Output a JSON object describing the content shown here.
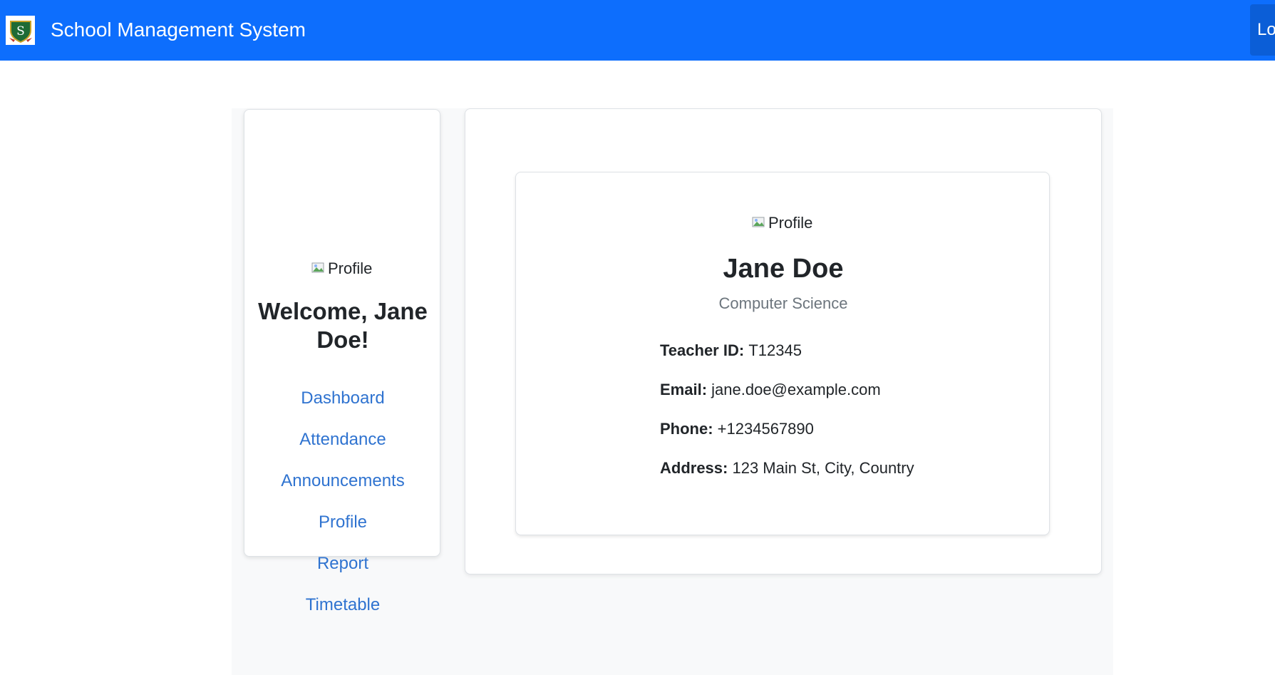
{
  "navbar": {
    "brand": "School Management System",
    "logo_letter": "S",
    "logout_label": "Lo"
  },
  "sidebar": {
    "profile_alt": "Profile",
    "welcome": "Welcome, Jane Doe!",
    "items": [
      {
        "label": "Dashboard"
      },
      {
        "label": "Attendance"
      },
      {
        "label": "Announcements"
      },
      {
        "label": "Profile"
      },
      {
        "label": "Report"
      },
      {
        "label": "Timetable"
      }
    ]
  },
  "profile": {
    "image_alt": "Profile",
    "name": "Jane Doe",
    "department": "Computer Science",
    "teacher_id_label": "Teacher ID:",
    "teacher_id": "T12345",
    "email_label": "Email:",
    "email": "jane.doe@example.com",
    "phone_label": "Phone:",
    "phone": "+1234567890",
    "address_label": "Address:",
    "address": "123 Main St, City, Country"
  },
  "colors": {
    "navbar": "#0d6efd",
    "link": "#2f73d0",
    "content_bg": "#f8f9fa"
  },
  "icons": {
    "logo": "school-shield-logo-icon",
    "broken_image": "broken-image-icon"
  }
}
